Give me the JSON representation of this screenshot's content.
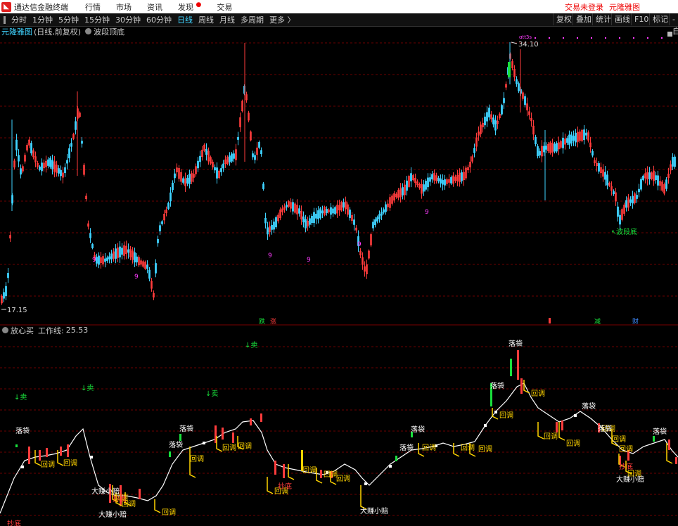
{
  "titlebar": {
    "app_name": "通达信金融终端",
    "menu": [
      "行情",
      "市场",
      "资讯",
      "发现",
      "交易"
    ],
    "trade_status": "交易未登录",
    "chart_name_link": "元隆雅图"
  },
  "toolbar": {
    "periods": [
      "分时",
      "1分钟",
      "5分钟",
      "15分钟",
      "30分钟",
      "60分钟",
      "日线",
      "周线",
      "月线",
      "多周期",
      "更多 〉"
    ],
    "active_period": "日线",
    "right_buttons": [
      "复权",
      "叠加",
      "统计",
      "画线",
      "F10",
      "标记",
      "-自"
    ]
  },
  "info": {
    "stock_name": "元隆雅图",
    "stock_sub": "(日线,前复权)",
    "indicator": "波段顶底"
  },
  "main_chart": {
    "high_label": "34.10",
    "low_label": "17.15",
    "bottom_signal": "波段底",
    "event_markers": [
      "跌",
      "涨",
      "",
      "减",
      "财"
    ],
    "td_marker": "9",
    "top_markers": "ɑtt3s"
  },
  "lower_panel": {
    "indicator": "放心买",
    "work_line_label": "工作线:",
    "work_line_value": "25.53",
    "sell_label": "↓卖",
    "labels": {
      "pocket": "落袋",
      "pullback": "回调",
      "bigwin": "大赚小赔",
      "bottom": "抄底"
    }
  },
  "colors": {
    "up": "#ff3c3c",
    "down": "#3fd3ff",
    "grid": "#6b0000",
    "accent": "#3fd3ff",
    "yellow": "#ffd400",
    "green": "#19e03c",
    "magenta": "#ff3cff"
  },
  "icons": {
    "logo": "tdx-logo-icon",
    "circle": "circle-toggle-icon"
  }
}
